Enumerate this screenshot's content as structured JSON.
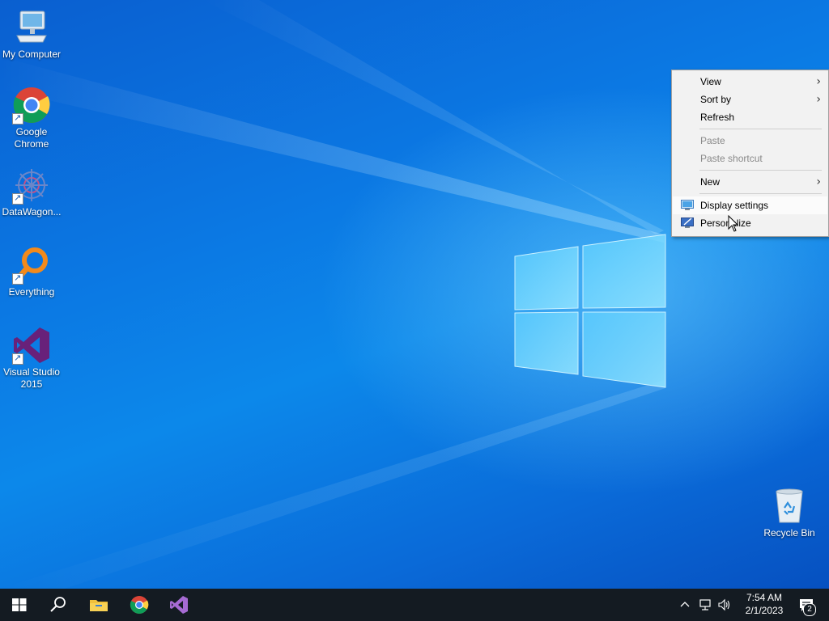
{
  "desktop": {
    "icons": [
      {
        "label": "My Computer",
        "icon": "computer-icon"
      },
      {
        "label": "Google Chrome",
        "icon": "chrome-icon"
      },
      {
        "label": "DataWagon...",
        "icon": "datawagon-icon"
      },
      {
        "label": "Everything",
        "icon": "everything-search-icon"
      },
      {
        "label": "Visual Studio 2015",
        "icon": "visual-studio-icon"
      },
      {
        "label": "Recycle Bin",
        "icon": "recycle-bin-icon"
      }
    ]
  },
  "context_menu": {
    "items": [
      {
        "label": "View",
        "submenu": true
      },
      {
        "label": "Sort by",
        "submenu": true
      },
      {
        "label": "Refresh"
      },
      {
        "label": "Paste",
        "disabled": true
      },
      {
        "label": "Paste shortcut",
        "disabled": true
      },
      {
        "label": "New",
        "submenu": true
      },
      {
        "label": "Display settings",
        "icon": "display-settings-icon",
        "hovered": true
      },
      {
        "label": "Personalize",
        "icon": "personalize-icon"
      }
    ]
  },
  "taskbar": {
    "buttons": [
      "start-icon",
      "search-icon",
      "file-explorer-icon",
      "chrome-icon",
      "visual-studio-icon"
    ],
    "tray_icons": [
      "chevron-up-icon",
      "network-icon",
      "volume-icon"
    ],
    "time": "7:54 AM",
    "date": "2/1/2023",
    "notification_count": "2"
  },
  "colors": {
    "taskbar_bg": "#141b22",
    "menu_bg": "#f2f2f2",
    "desktop_blue": "#0b78e3"
  }
}
